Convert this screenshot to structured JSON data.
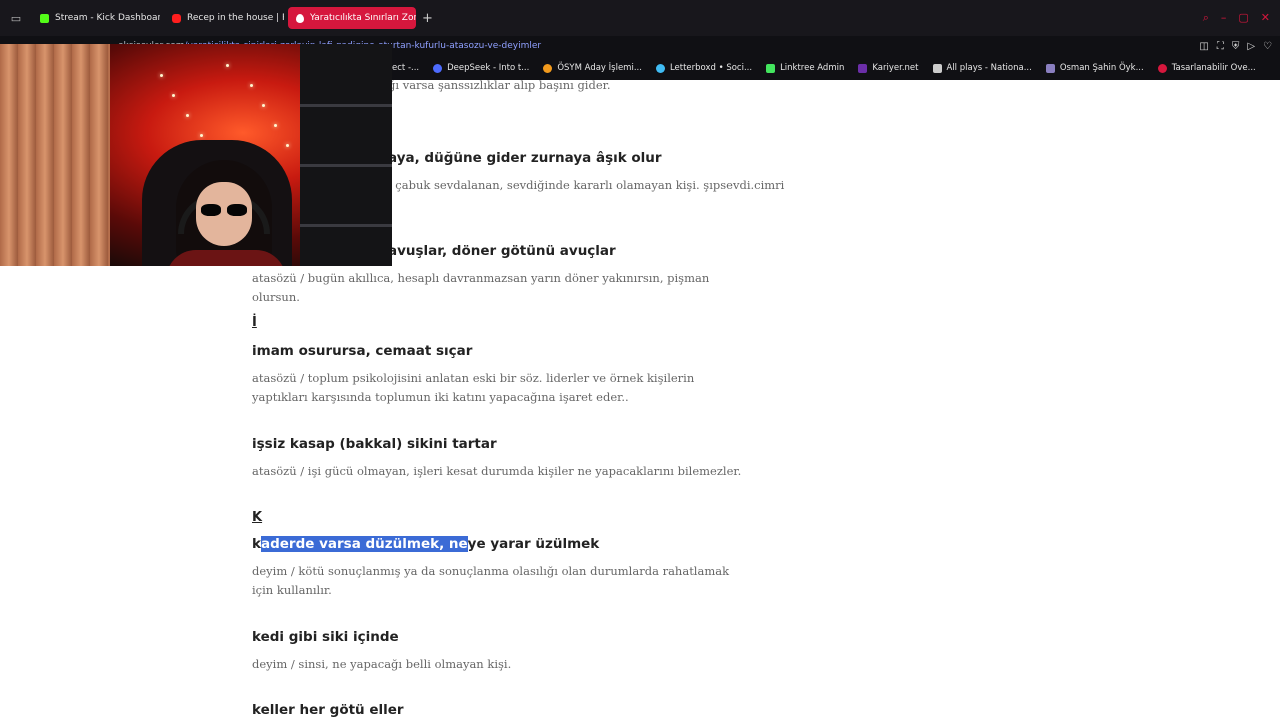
{
  "browser": {
    "tabs": [
      {
        "label": "Stream - Kick Dashboard",
        "icon": "kick-icon",
        "active": false
      },
      {
        "label": "Recep in the house | Rece",
        "icon": "youtube-icon",
        "active": false
      },
      {
        "label": "Yaratıcılıkta Sınırları Zorlay",
        "icon": "drop-icon",
        "active": true
      }
    ],
    "new_tab": "+",
    "url_host": "eksiseyler.com",
    "url_path": "/yaraticilikta-sinirlari-zorlayip-lafi-gadigine-oturtan-kufurlu-atasozu-ve-deyimler",
    "bookmarks": [
      {
        "label": "ect -...",
        "color": "#888888"
      },
      {
        "label": "DeepSeek - Into t...",
        "color": "#4d6bfe"
      },
      {
        "label": "ÖSYM Aday İşlemi...",
        "color": "#f29a1d"
      },
      {
        "label": "Letterboxd • Soci...",
        "color": "#40bcf4"
      },
      {
        "label": "Linktree Admin",
        "color": "#43e55e"
      },
      {
        "label": "Kariyer.net",
        "color": "#6b2ea8"
      },
      {
        "label": "All plays - Nationa...",
        "color": "#cccccc"
      },
      {
        "label": "Osman Şahin Öyk...",
        "color": "#8a7fc0"
      },
      {
        "label": "Tasarlanabilir Ove...",
        "color": "#d6173d"
      }
    ]
  },
  "page": {
    "entry0_desc": "ğı varsa şanssızlıklar alıp başını gider.",
    "entry1_title": "aya, düğüne gider zurnaya âşık olur",
    "entry1_desc": ", çabuk sevdalanan, sevdiğinde kararlı olamayan kişi. şıpsevdi.cimri",
    "entry2_title": "avuşlar, döner götünü avuçlar",
    "entry2_desc": "atasözü / bugün akıllıca, hesaplı davranmazsan yarın döner yakınırsın, pişman olursun.",
    "letter_i": "İ",
    "entry3_title": "imam osurursa, cemaat sıçar",
    "entry3_desc": "atasözü / toplum psikolojisini anlatan eski bir söz. liderler ve örnek kişilerin yaptıkları karşısında toplumun iki katını yapacağına işaret eder..",
    "entry4_title": "işsiz kasap (bakkal) sikini tartar",
    "entry4_desc": "atasözü / işi gücü olmayan, işleri kesat durumda kişiler ne yapacaklarını bilemezler.",
    "letter_k": "K",
    "entry5_title_pre": "k",
    "entry5_title_hl": "aderde varsa düzülmek, ne",
    "entry5_title_post": "ye yarar üzülmek",
    "entry5_desc": "deyim / kötü sonuçlanmış ya da sonuçlanma olasılığı olan durumlarda rahatlamak için kullanılır.",
    "entry6_title": "kedi gibi siki içinde",
    "entry6_desc": "deyim / sinsi, ne yapacağı belli olmayan kişi.",
    "entry7_title": "keller her götü eller"
  }
}
